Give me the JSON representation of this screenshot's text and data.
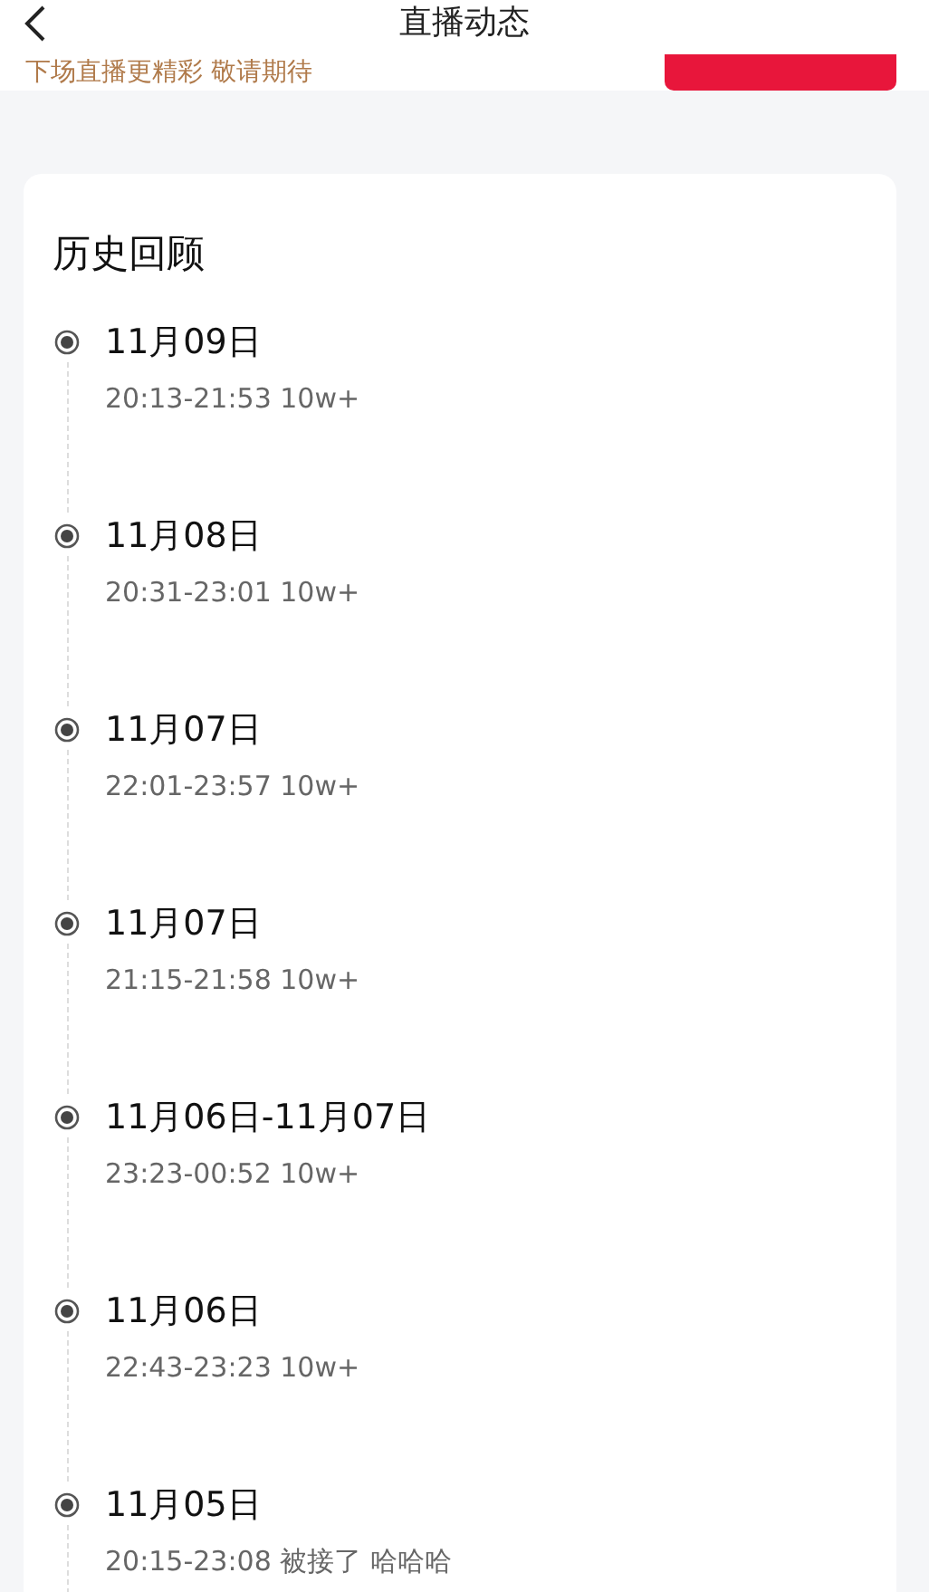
{
  "header": {
    "title": "直播动态"
  },
  "notice": {
    "text": "下场直播更精彩 敬请期待"
  },
  "history": {
    "title": "历史回顾",
    "items": [
      {
        "date": "11月09日",
        "detail": "20:13-21:53 10w+"
      },
      {
        "date": "11月08日",
        "detail": "20:31-23:01 10w+"
      },
      {
        "date": "11月07日",
        "detail": "22:01-23:57 10w+"
      },
      {
        "date": "11月07日",
        "detail": "21:15-21:58 10w+"
      },
      {
        "date": "11月06日-11月07日",
        "detail": "23:23-00:52 10w+"
      },
      {
        "date": "11月06日",
        "detail": "22:43-23:23 10w+"
      },
      {
        "date": "11月05日",
        "detail": "20:15-23:08 被接了 哈哈哈"
      }
    ]
  }
}
